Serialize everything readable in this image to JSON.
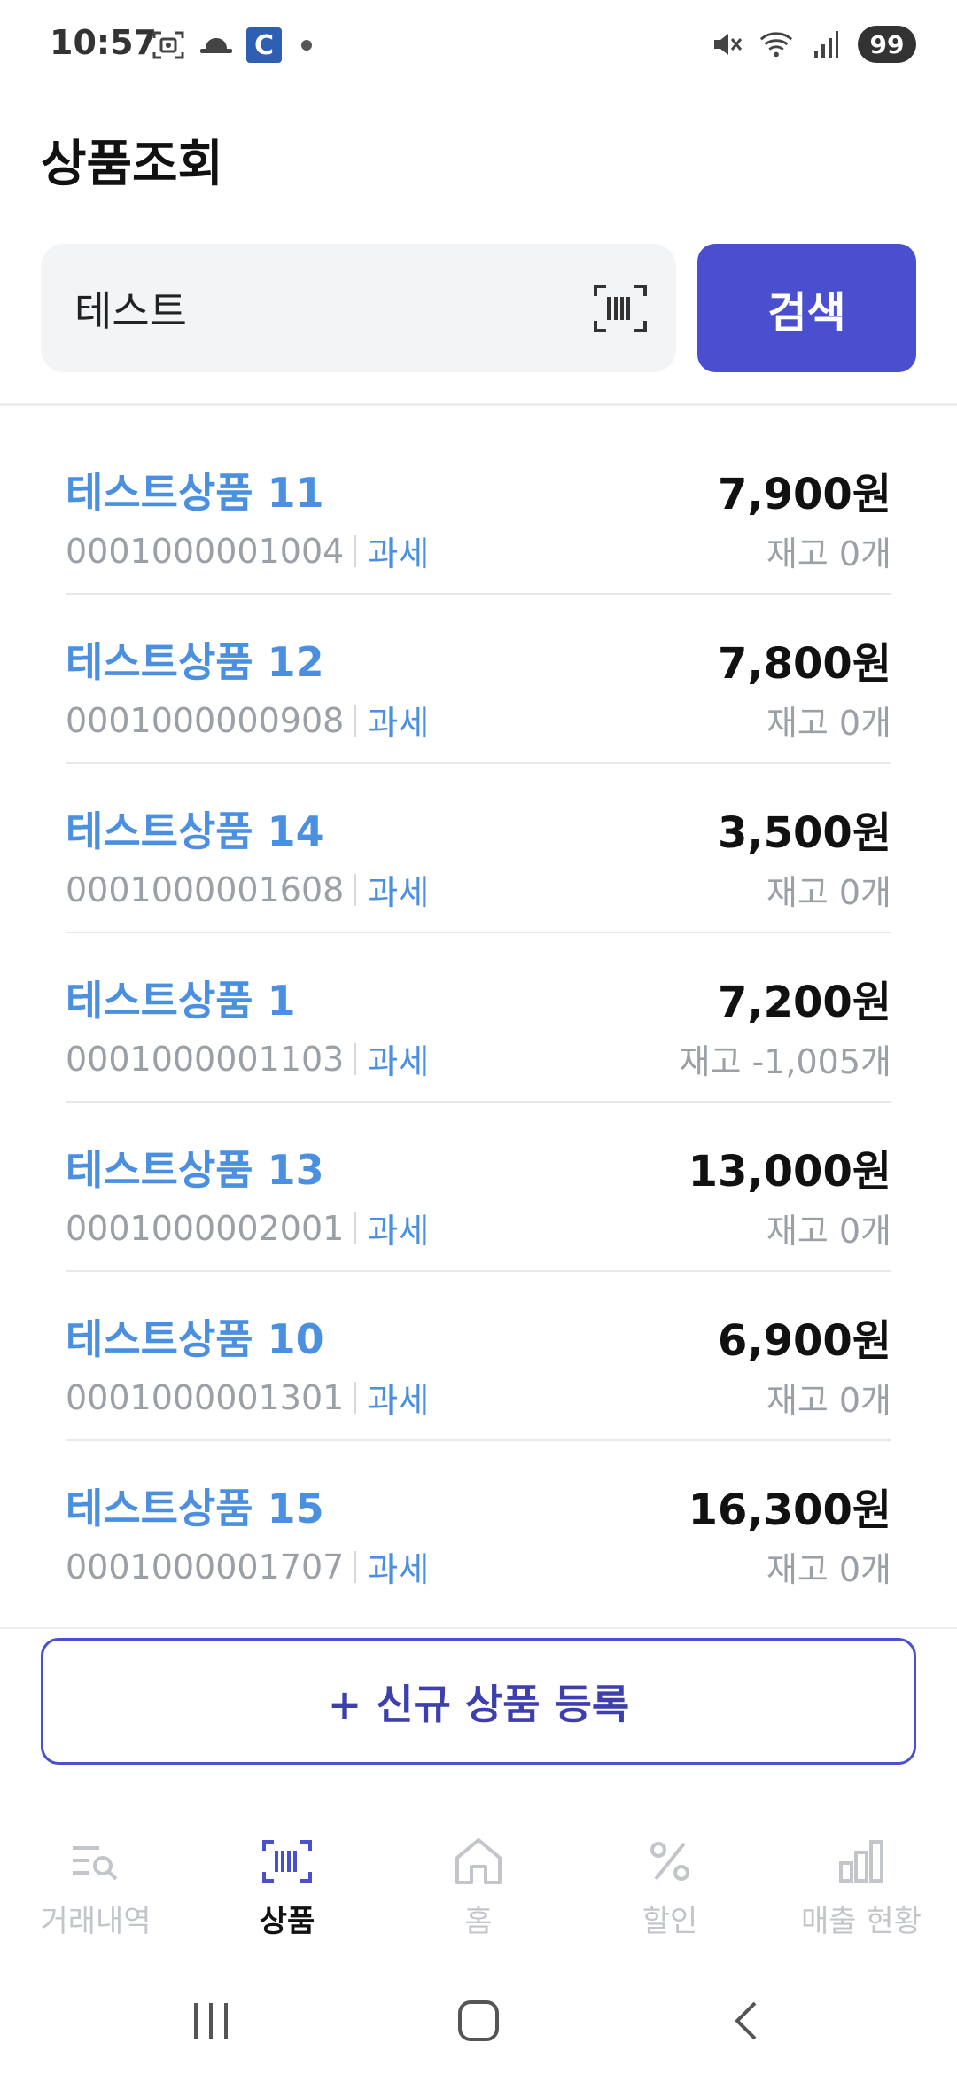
{
  "status_bar": {
    "time": "10:57",
    "c_badge": "C",
    "battery": "99",
    "icons_left": [
      "screenshot-icon",
      "hat-icon",
      "c-app-icon",
      "dot-icon"
    ],
    "icons_right": [
      "mute-icon",
      "wifi-icon",
      "signal-icon",
      "battery-icon"
    ]
  },
  "page": {
    "title": "상품조회"
  },
  "search": {
    "value": "테스트",
    "button_label": "검색"
  },
  "products": [
    {
      "name": "테스트상품 11",
      "code": "0001000001004",
      "tax": "과세",
      "price": "7,900원",
      "stock": "재고 0개"
    },
    {
      "name": "테스트상품 12",
      "code": "0001000000908",
      "tax": "과세",
      "price": "7,800원",
      "stock": "재고 0개"
    },
    {
      "name": "테스트상품 14",
      "code": "0001000001608",
      "tax": "과세",
      "price": "3,500원",
      "stock": "재고 0개"
    },
    {
      "name": "테스트상품 1",
      "code": "0001000001103",
      "tax": "과세",
      "price": "7,200원",
      "stock": "재고 -1,005개"
    },
    {
      "name": "테스트상품 13",
      "code": "0001000002001",
      "tax": "과세",
      "price": "13,000원",
      "stock": "재고 0개"
    },
    {
      "name": "테스트상품 10",
      "code": "0001000001301",
      "tax": "과세",
      "price": "6,900원",
      "stock": "재고 0개"
    },
    {
      "name": "테스트상품 15",
      "code": "0001000001707",
      "tax": "과세",
      "price": "16,300원",
      "stock": "재고 0개"
    }
  ],
  "register_button": {
    "label": "+ 신규 상품 등록"
  },
  "bottom_nav": [
    {
      "label": "거래내역",
      "icon": "transactions-icon",
      "active": false
    },
    {
      "label": "상품",
      "icon": "barcode-icon",
      "active": true
    },
    {
      "label": "홈",
      "icon": "home-icon",
      "active": false
    },
    {
      "label": "할인",
      "icon": "percent-icon",
      "active": false
    },
    {
      "label": "매출 현황",
      "icon": "bar-chart-icon",
      "active": false
    }
  ],
  "colors": {
    "accent": "#4a4fcf",
    "link_blue": "#4a8fe0",
    "muted": "#9aa0a6",
    "nav_inactive": "#c2c5ca"
  }
}
